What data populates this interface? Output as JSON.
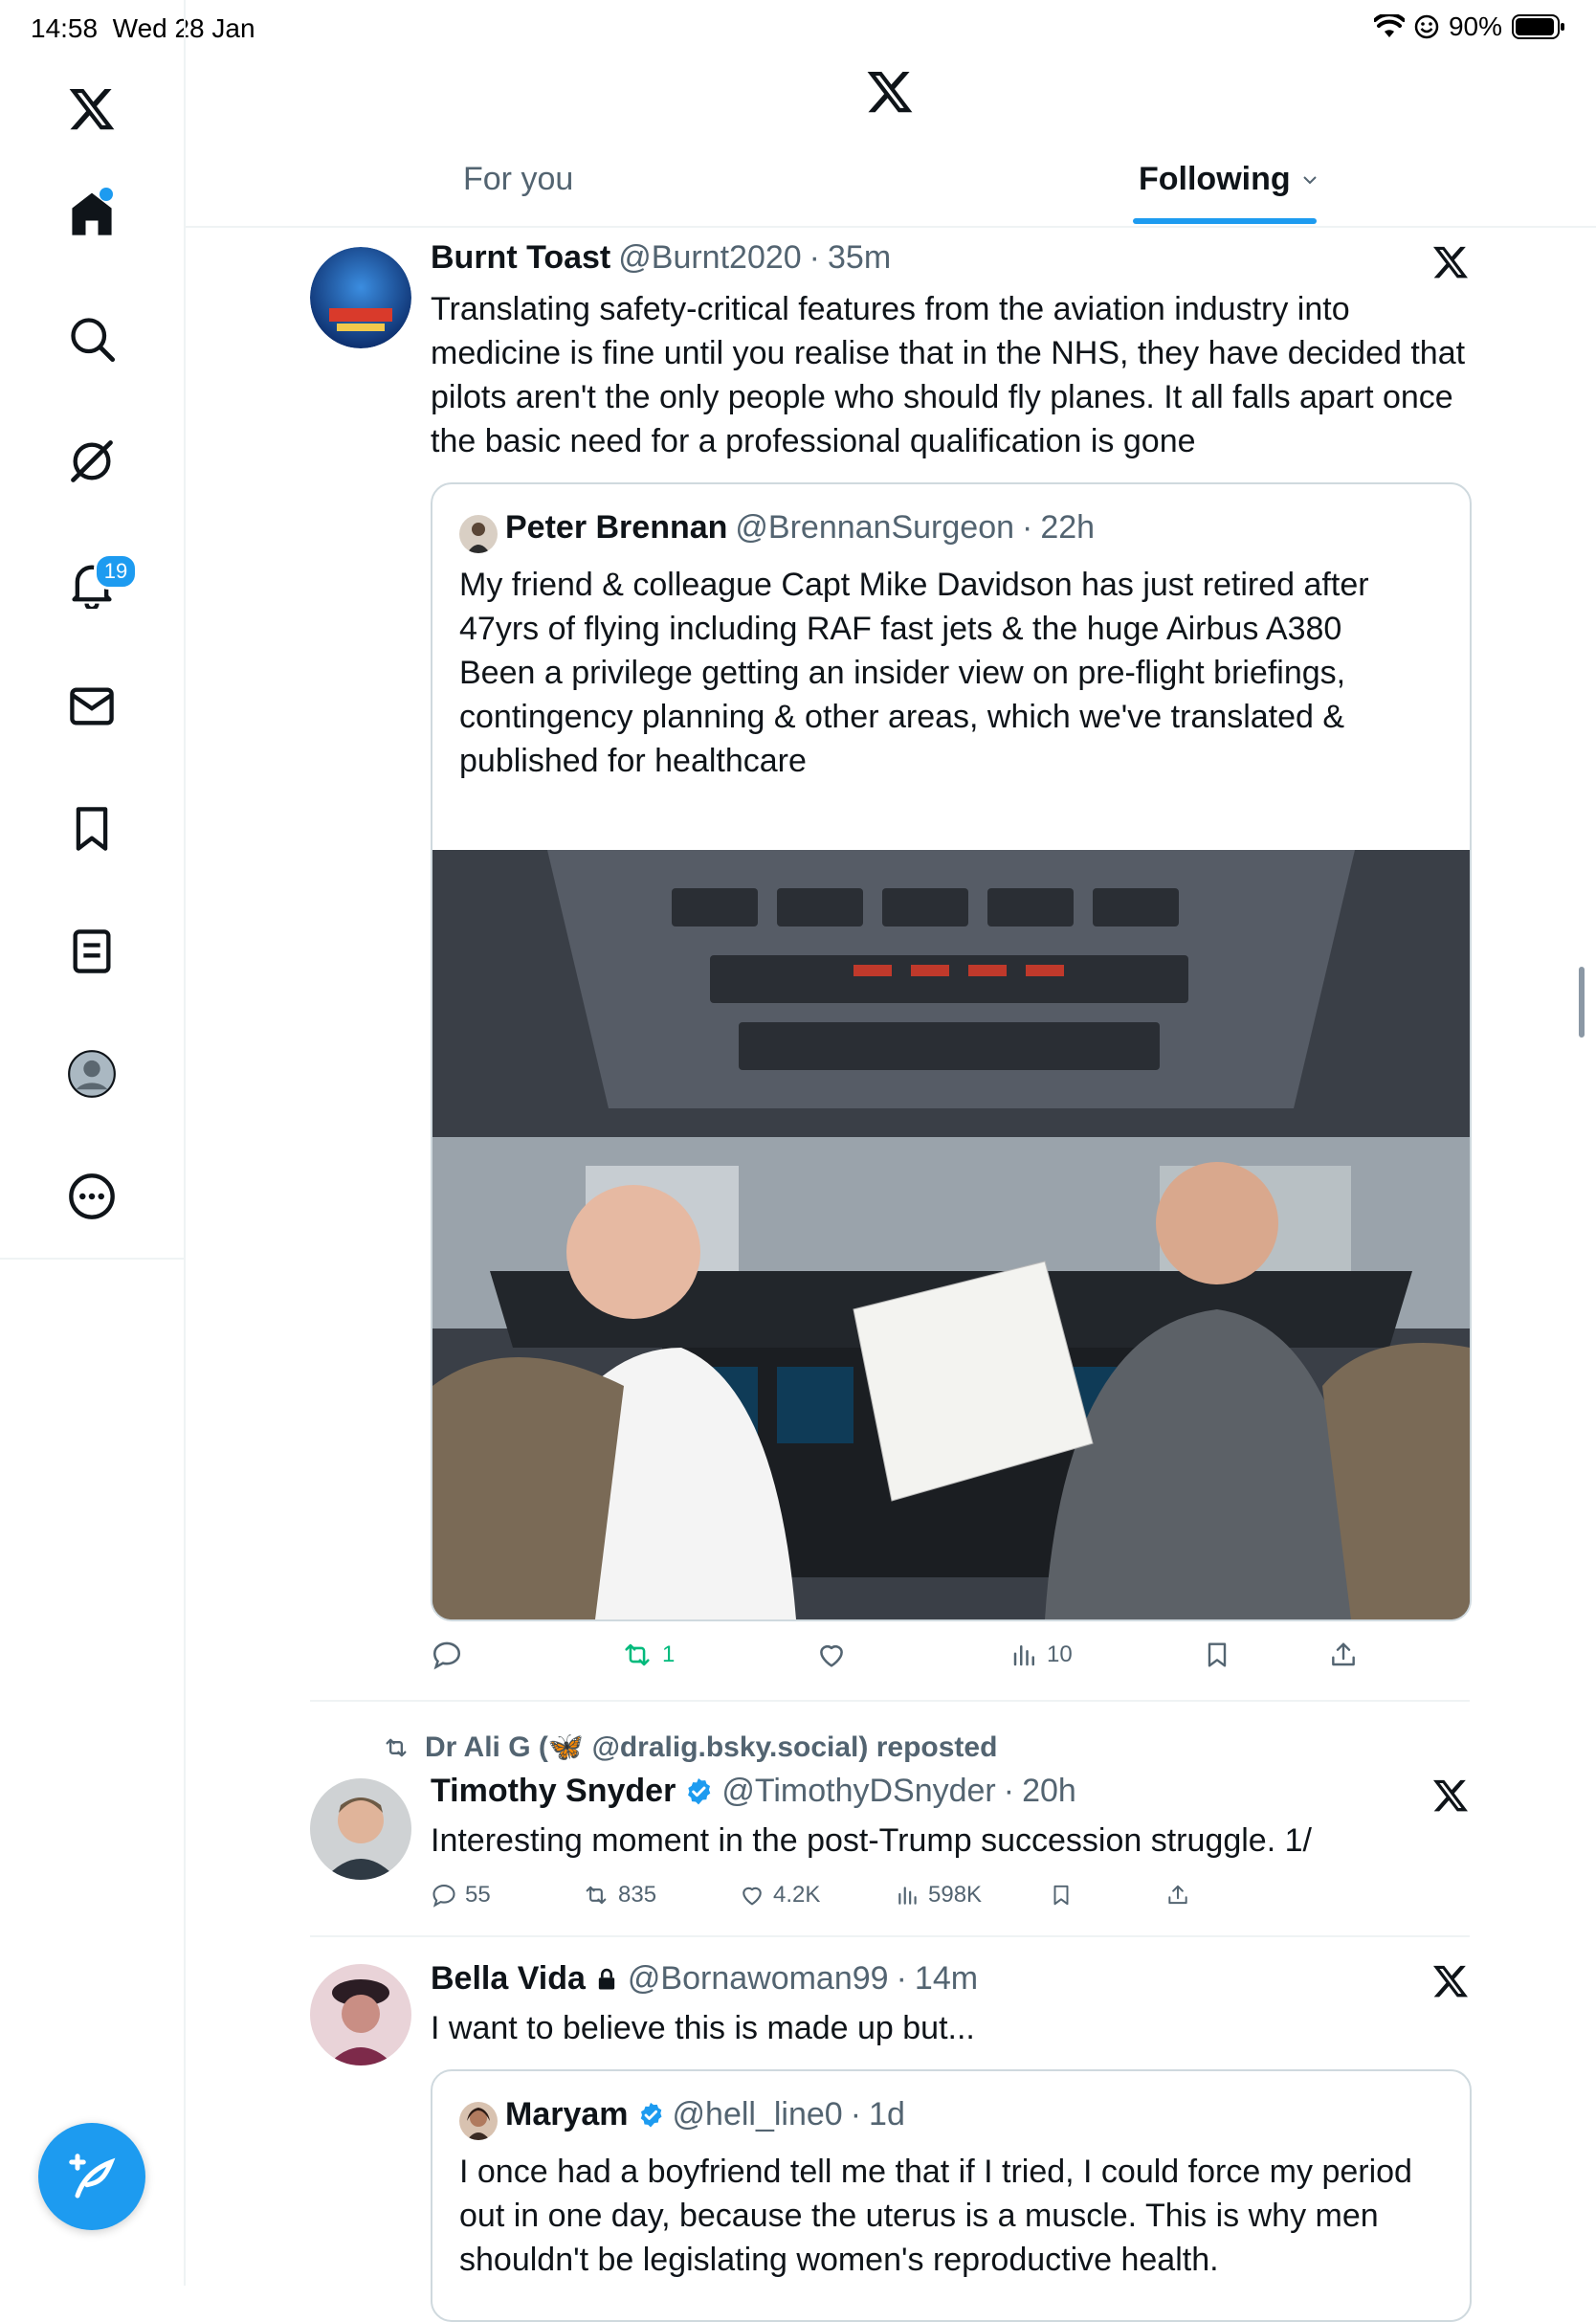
{
  "status_bar": {
    "time": "14:58",
    "date": "Wed 28 Jan",
    "battery": "90%"
  },
  "sidebar": {
    "notifications_badge": "19"
  },
  "header": {
    "tabs": [
      {
        "label": "For you"
      },
      {
        "label": "Following"
      }
    ]
  },
  "posts": [
    {
      "name": "Burnt Toast",
      "handle": "@Burnt2020",
      "time": "35m",
      "dot": "·",
      "text": "Translating safety-critical features from the aviation industry into medicine is fine until you realise that in the NHS, they have decided that pilots aren't the only people who should fly planes. It all falls apart once the basic need for a professional qualification is gone",
      "quote": {
        "name": "Peter Brennan",
        "handle": "@BrennanSurgeon",
        "time": "22h",
        "text1": "My friend & colleague Capt Mike Davidson has just retired after 47yrs of flying including RAF fast jets & the huge Airbus A380",
        "text2": "Been a privilege getting an insider view on pre-flight briefings, contingency planning & other areas, which we've translated & published for healthcare"
      },
      "actions": {
        "reposts": "1",
        "views": "10"
      }
    },
    {
      "repost_by": "Dr Ali G (🦋 @dralig.bsky.social) reposted",
      "name": "Timothy Snyder",
      "handle": "@TimothyDSnyder",
      "time": "20h",
      "dot": "·",
      "text": "Interesting moment in the post-Trump succession struggle. 1/",
      "actions": {
        "replies": "55",
        "reposts": "835",
        "likes": "4.2K",
        "views": "598K"
      }
    },
    {
      "name": "Bella Vida",
      "handle": "@Bornawoman99",
      "time": "14m",
      "dot": "·",
      "text": "I want to believe this is made up but...",
      "quote": {
        "name": "Maryam",
        "handle": "@hell_line0",
        "time": "1d",
        "text1": "I once had a boyfriend tell me that if I tried, I could force my period out in one day, because the uterus is a muscle. This is why men shouldn't be legislating women's reproductive health."
      }
    }
  ],
  "colors": {
    "accent": "#1d9bf0",
    "repost_green": "#00ba7c",
    "muted": "#536471"
  }
}
